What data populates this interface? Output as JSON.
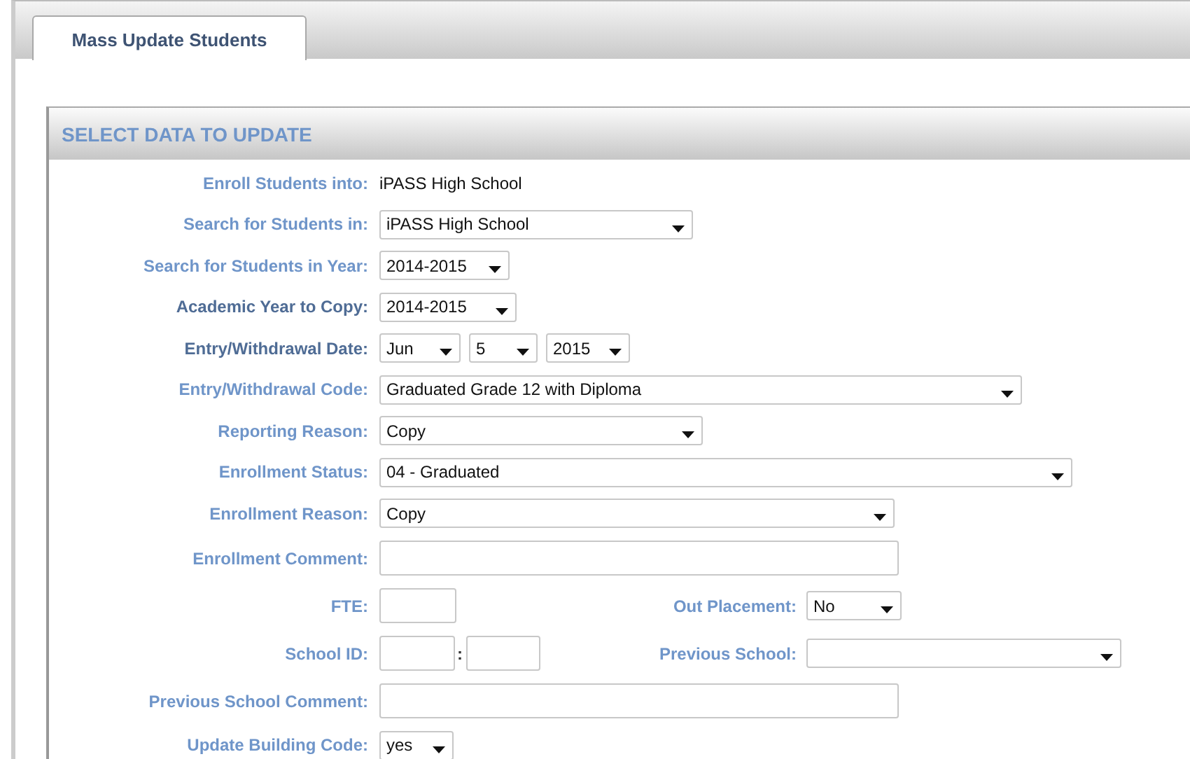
{
  "tabs": [
    {
      "label": "Mass Update Students",
      "selected": true
    }
  ],
  "panel": {
    "title": "SELECT DATA TO UPDATE"
  },
  "rows": [
    {
      "label": "Enroll Students into:",
      "color": "#6f95c9",
      "controls": [
        {
          "kind": "text",
          "value": "iPASS High School"
        }
      ]
    },
    {
      "label": "Search for Students in:",
      "color": "#6f95c9",
      "controls": [
        {
          "kind": "select",
          "value": "iPASS High School"
        }
      ]
    },
    {
      "label": "Search for Students in Year:",
      "color": "#6f95c9",
      "controls": [
        {
          "kind": "select",
          "value": "2014-2015"
        }
      ]
    },
    {
      "label": "Academic Year to Copy:",
      "color": "#4f6c95",
      "controls": [
        {
          "kind": "select",
          "value": "2014-2015"
        }
      ]
    },
    {
      "label": "Entry/Withdrawal Date:",
      "color": "#4f6c95",
      "controls": [
        {
          "kind": "select",
          "value": "Jun"
        },
        {
          "kind": "select",
          "value": "5"
        },
        {
          "kind": "select",
          "value": "2015"
        }
      ]
    },
    {
      "label": "Entry/Withdrawal Code:",
      "color": "#6f95c9",
      "controls": [
        {
          "kind": "select",
          "value": "Graduated Grade 12 with Diploma"
        }
      ]
    },
    {
      "label": "Reporting Reason:",
      "color": "#6f95c9",
      "controls": [
        {
          "kind": "select",
          "value": "Copy"
        }
      ]
    },
    {
      "label": "Enrollment Status:",
      "color": "#6f95c9",
      "controls": [
        {
          "kind": "select",
          "value": "04 - Graduated"
        }
      ]
    },
    {
      "label": "Enrollment Reason:",
      "color": "#6f95c9",
      "controls": [
        {
          "kind": "select",
          "value": "Copy"
        }
      ]
    },
    {
      "label": "Enrollment Comment:",
      "color": "#6f95c9",
      "controls": [
        {
          "kind": "input"
        }
      ]
    },
    {
      "label": "FTE:",
      "color": "#6f95c9",
      "controls": [
        {
          "kind": "input"
        }
      ],
      "side": {
        "label": "Out Placement:",
        "controls": [
          {
            "kind": "select",
            "value": "No"
          }
        ]
      }
    },
    {
      "label": "School ID:",
      "color": "#6f95c9",
      "controls": [
        {
          "kind": "input"
        },
        {
          "kind": "separator",
          "value": ":"
        },
        {
          "kind": "input"
        }
      ],
      "side": {
        "label": "Previous School:",
        "controls": [
          {
            "kind": "select"
          }
        ]
      }
    },
    {
      "label": "Previous School Comment:",
      "color": "#6f95c9",
      "controls": [
        {
          "kind": "input"
        }
      ]
    },
    {
      "label": "Update Building Code:",
      "color": "#6f95c9",
      "controls": [
        {
          "kind": "select",
          "value": "yes"
        }
      ]
    }
  ]
}
